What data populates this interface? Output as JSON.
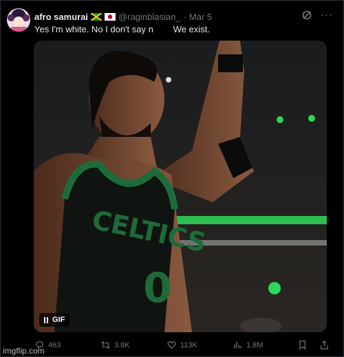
{
  "tweet": {
    "display_name": "afro samurai",
    "flags": [
      "jamaica-flag",
      "japan-flag"
    ],
    "handle": "@raginblasian_",
    "separator": "·",
    "date": "Mar 5",
    "text": "Yes I'm white. No I don't say n        We exist.",
    "media": {
      "type": "gif",
      "badge_label": "GIF",
      "jersey_text": "CELTICS",
      "jersey_number": "0"
    },
    "actions": {
      "replies": "463",
      "reposts": "3.8K",
      "likes": "113K",
      "views": "1.8M"
    },
    "more_icon": "ellipsis-icon",
    "grok_icon": "grok-icon"
  },
  "watermark": "imgflip.com",
  "colors": {
    "background": "#000000",
    "text": "#e7e9ea",
    "muted": "#71767b",
    "jersey_green": "#1e6b3a"
  }
}
